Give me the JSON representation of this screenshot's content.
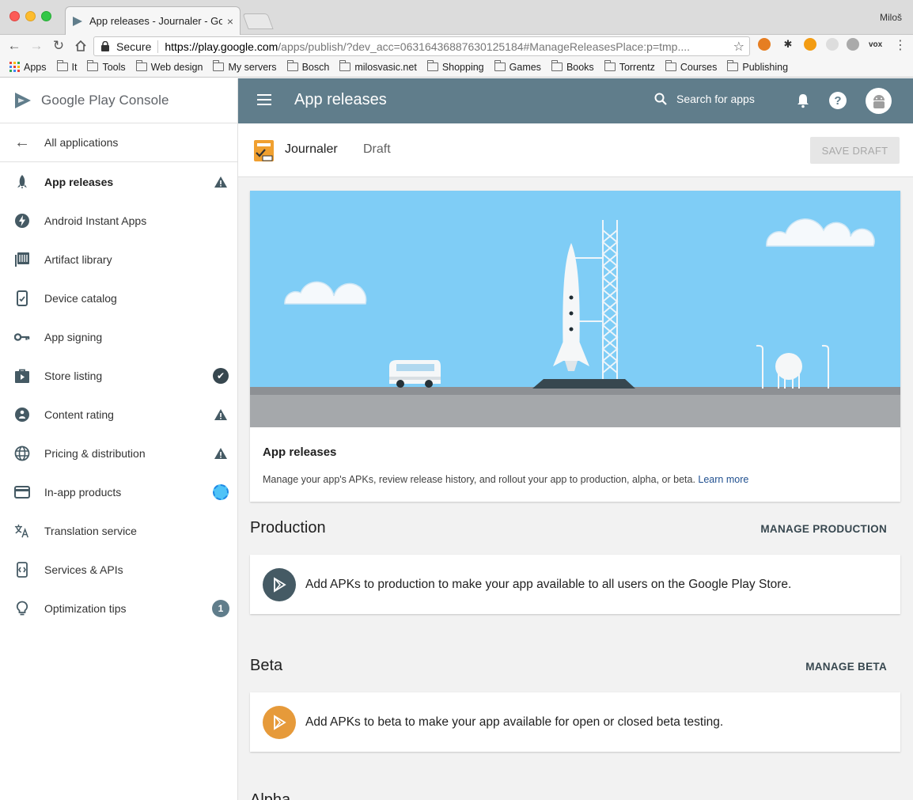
{
  "browser": {
    "tab_title": "App releases - Journaler - Goo",
    "tab_close": "×",
    "profile": "Miloš",
    "secure_label": "Secure",
    "url_host": "https://play.google.com",
    "url_rest": "/apps/publish/?dev_acc=06316436887630125184#ManageReleasesPlace:p=tmp....",
    "bookmarks": [
      "Apps",
      "It",
      "Tools",
      "Web design",
      "My servers",
      "Bosch",
      "milosvasic.net",
      "Shopping",
      "Games",
      "Books",
      "Torrentz",
      "Courses",
      "Publishing"
    ],
    "extension_label": "vox"
  },
  "sidebar": {
    "brand": "Google Play Console",
    "back_label": "All applications",
    "items": [
      {
        "label": "App releases",
        "icon": "rocket-icon",
        "status": "warning"
      },
      {
        "label": "Android Instant Apps",
        "icon": "lightning-icon",
        "status": ""
      },
      {
        "label": "Artifact library",
        "icon": "library-icon",
        "status": ""
      },
      {
        "label": "Device catalog",
        "icon": "device-icon",
        "status": ""
      },
      {
        "label": "App signing",
        "icon": "key-icon",
        "status": ""
      },
      {
        "label": "Store listing",
        "icon": "store-icon",
        "status": "complete"
      },
      {
        "label": "Content rating",
        "icon": "rating-icon",
        "status": "warning"
      },
      {
        "label": "Pricing & distribution",
        "icon": "globe-icon",
        "status": "warning"
      },
      {
        "label": "In-app products",
        "icon": "card-icon",
        "status": "loading"
      },
      {
        "label": "Translation service",
        "icon": "translate-icon",
        "status": ""
      },
      {
        "label": "Services & APIs",
        "icon": "api-icon",
        "status": ""
      },
      {
        "label": "Optimization tips",
        "icon": "bulb-icon",
        "status": "count",
        "count": "1"
      }
    ]
  },
  "appbar": {
    "title": "App releases",
    "search_label": "Search for apps"
  },
  "draft": {
    "app_name": "Journaler",
    "status": "Draft",
    "save_label": "SAVE DRAFT"
  },
  "hero": {
    "title": "App releases",
    "description": "Manage your app's APKs, review release history, and rollout your app to production, alpha, or beta.",
    "learn_more": "Learn more"
  },
  "production": {
    "title": "Production",
    "action": "MANAGE PRODUCTION",
    "message": "Add APKs to production to make your app available to all users on the Google Play Store."
  },
  "beta": {
    "title": "Beta",
    "action": "MANAGE BETA",
    "message": "Add APKs to beta to make your app available for open or closed beta testing."
  },
  "next_section": {
    "title": "Alpha"
  },
  "colors": {
    "appbar": "#607d8b",
    "production_icon": "#455a64",
    "beta_icon": "#e69a3a",
    "sky": "#7fcdf6"
  }
}
